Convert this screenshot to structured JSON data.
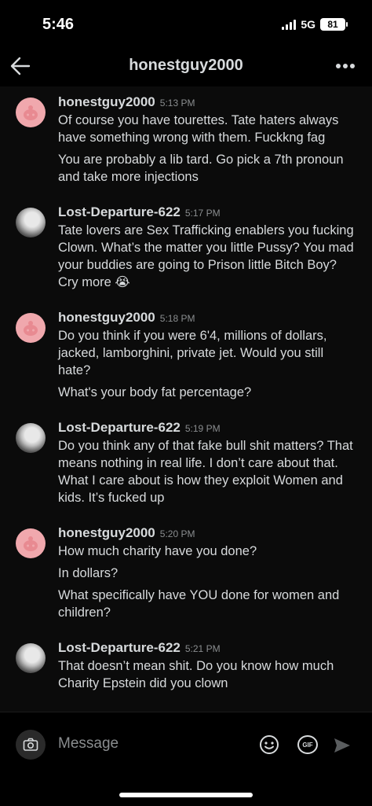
{
  "status_bar": {
    "time": "5:46",
    "network": "5G",
    "battery": "81"
  },
  "header": {
    "title": "honestguy2000",
    "back_icon": "arrow-left-icon",
    "more_icon": "more-horizontal-icon"
  },
  "messages": [
    {
      "author": "honestguy2000",
      "time": "5:13 PM",
      "avatar": "reddit-snoo-pink",
      "lines": [
        "Of course you have tourettes. Tate haters always have something wrong with them. Fuckkng fag",
        "You are probably a lib tard. Go pick a 7th pronoun and take more injections"
      ]
    },
    {
      "author": "Lost-Departure-622",
      "time": "5:17 PM",
      "avatar": "dog-photo",
      "lines": [
        "Tate lovers are Sex Trafficking enablers you fucking Clown. What’s the matter you little Pussy? You mad your buddies are going to Prison little Bitch Boy? Cry more 😭"
      ]
    },
    {
      "author": "honestguy2000",
      "time": "5:18 PM",
      "avatar": "reddit-snoo-pink",
      "lines": [
        "Do you think if you were 6'4, millions of dollars, jacked, lamborghini, private jet. Would you still hate?",
        "What's your body fat percentage?"
      ]
    },
    {
      "author": "Lost-Departure-622",
      "time": "5:19 PM",
      "avatar": "dog-photo",
      "lines": [
        "Do you think any of that fake bull shit matters? That means nothing in real life. I don’t care about that. What I care about is how they exploit Women and kids. It’s fucked up"
      ]
    },
    {
      "author": "honestguy2000",
      "time": "5:20 PM",
      "avatar": "reddit-snoo-pink",
      "lines": [
        "How much charity have you done?",
        "In dollars?",
        "What specifically have YOU done for women and children?"
      ]
    },
    {
      "author": "Lost-Departure-622",
      "time": "5:21 PM",
      "avatar": "dog-photo",
      "lines": [
        "That doesn’t mean shit. Do you know how much Charity Epstein did you clown"
      ]
    }
  ],
  "composer": {
    "placeholder": "Message",
    "camera_icon": "camera-icon",
    "emoji_icon": "emoji-icon",
    "gif_label": "GIF",
    "send_icon": "send-icon"
  }
}
